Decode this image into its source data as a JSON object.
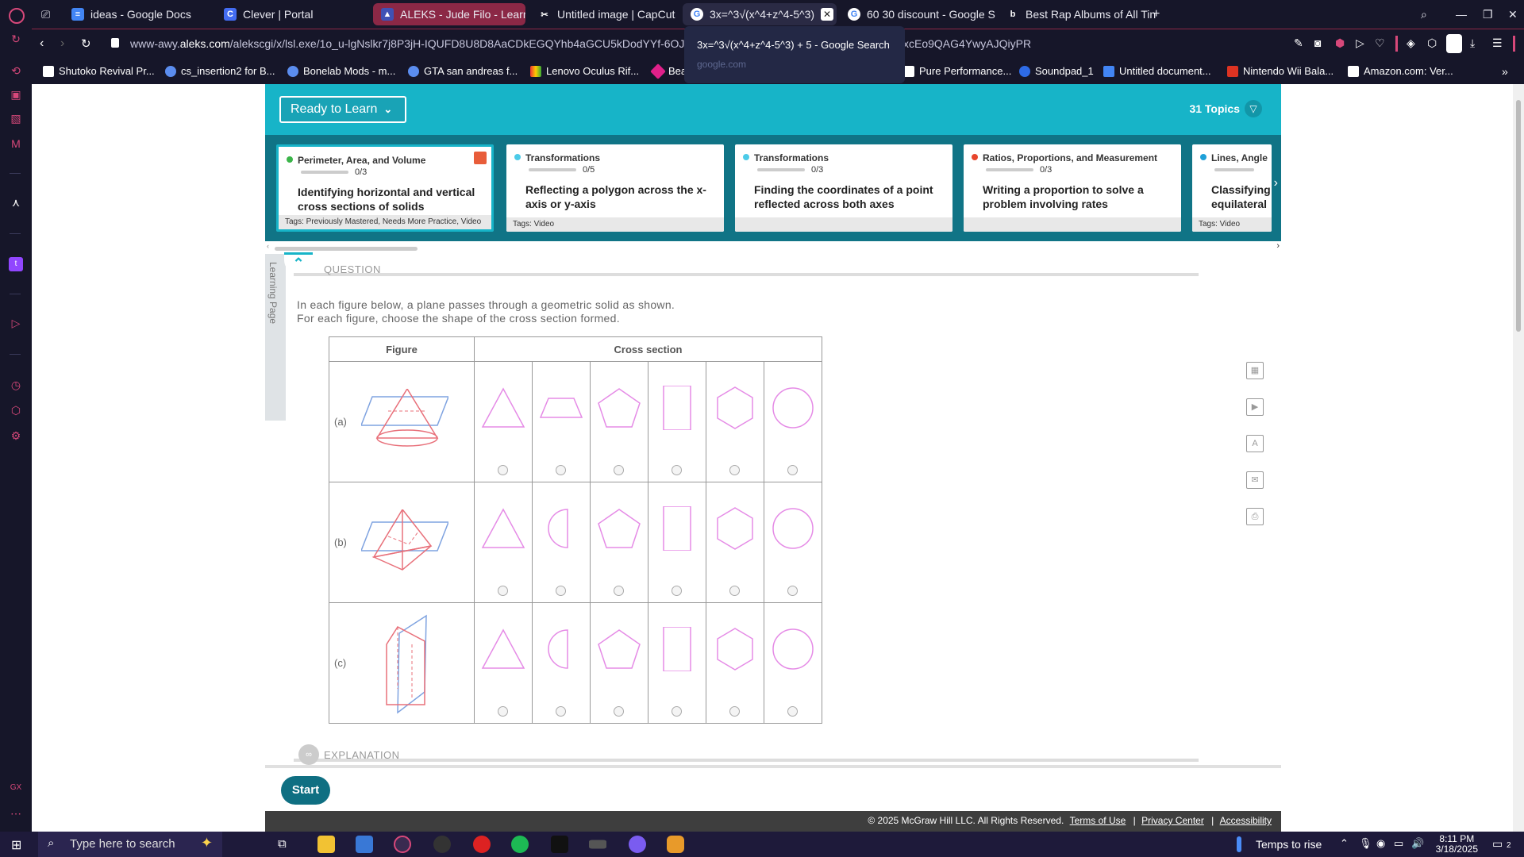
{
  "browser": {
    "tabs": [
      {
        "label": "ideas - Google Docs",
        "icon": "docs-icon",
        "color": "#4285f4"
      },
      {
        "label": "Clever | Portal",
        "icon": "clever-icon",
        "color": "#436cf2"
      },
      {
        "label": "ALEKS - Jude Filo - Learn",
        "icon": "aleks-icon",
        "color": "#3f51b5"
      },
      {
        "label": "Untitled image | CapCut",
        "icon": "capcut-icon",
        "color": "#ffffff"
      },
      {
        "label": "3x=^3√(x^4+z^4-5^3)",
        "icon": "google-icon",
        "color": "#ffffff"
      },
      {
        "label": "60 30 discount - Google S",
        "icon": "google-icon",
        "color": "#ffffff"
      },
      {
        "label": "Best Rap Albums of All Tin",
        "icon": "bing-icon",
        "color": "#ffffff"
      }
    ],
    "url_pre": "www-awy.",
    "url_host": "aleks.com",
    "url_path": "/alekscgi/x/lsl.exe/1o_u-lgNslkr7j8P3jH-IQUFD8U8D8AaCDkEGQYhb4aGCU5kDodYYf-6OJc",
    "url_tail": "xcEo9QAG4YwyAJQiyPR",
    "bookmarks": [
      "Shutoko Revival Pr...",
      "cs_insertion2 for B...",
      "Bonelab Mods - m...",
      "GTA san andreas f...",
      "Lenovo Oculus Rif...",
      "Bea",
      "Pure Performance...",
      "Soundpad_1",
      "Untitled document...",
      "Nintendo Wii Bala...",
      "Amazon.com: Ver..."
    ],
    "tooltip_title": "3x=^3√(x^4+z^4-5^3) + 5 - Google Search",
    "tooltip_sub": "google.com"
  },
  "aleks": {
    "ready_label": "Ready to Learn",
    "topics_label": "31 Topics",
    "cards": [
      {
        "category": "Perimeter, Area, and Volume",
        "progress": "0/3",
        "title": "Identifying horizontal and vertical cross sections of solids",
        "tags": "Tags: Previously Mastered, Needs More Practice, Video",
        "dot": "#3bb54a"
      },
      {
        "category": "Transformations",
        "progress": "0/5",
        "title": "Reflecting a polygon across the x-axis or y-axis",
        "tags": "Tags: Video",
        "dot": "#4ccbe8"
      },
      {
        "category": "Transformations",
        "progress": "0/3",
        "title": "Finding the coordinates of a point reflected across both axes",
        "tags": "",
        "dot": "#4ccbe8"
      },
      {
        "category": "Ratios, Proportions, and Measurement",
        "progress": "0/3",
        "title": "Writing a proportion to solve a problem involving rates",
        "tags": "",
        "dot": "#e8452c"
      },
      {
        "category": "Lines, Angle",
        "progress": "",
        "title": "Classifying equilateral",
        "tags": "Tags: Video",
        "dot": "#1ea0d8"
      }
    ],
    "learning_page": "Learning Page",
    "question_label": "QUESTION",
    "prompt_line1": "In each figure below, a plane passes through a geometric solid as shown.",
    "prompt_line2": "For each figure, choose the shape of the cross section formed.",
    "table": {
      "col_figure": "Figure",
      "col_cross": "Cross section",
      "rows": [
        "(a)",
        "(b)",
        "(c)"
      ]
    },
    "explanation_label": "EXPLANATION",
    "start_label": "Start",
    "footer": {
      "copyright": "© 2025 McGraw Hill LLC. All Rights Reserved.",
      "terms": "Terms of Use",
      "privacy": "Privacy Center",
      "accessibility": "Accessibility"
    }
  },
  "taskbar": {
    "search_placeholder": "Type here to search",
    "weather": "Temps to rise",
    "time": "8:11 PM",
    "date": "3/18/2025",
    "notif_count": "2"
  },
  "colors": {
    "accent": "#17b4c8",
    "brand_dark": "#0f6f82",
    "shape_stroke": "#e58be6"
  }
}
